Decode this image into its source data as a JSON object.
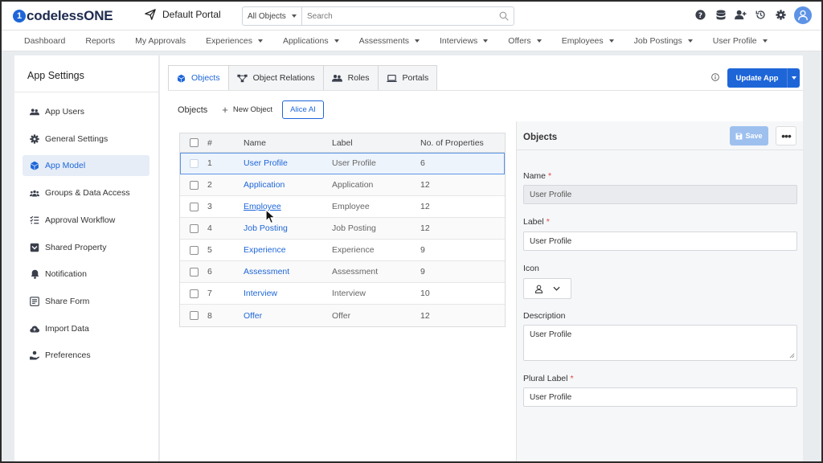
{
  "app": {
    "logo_text": "codelessONE",
    "portal_name": "Default Portal"
  },
  "search": {
    "scope": "All Objects",
    "placeholder": "Search"
  },
  "top_icons": [
    "help-icon",
    "database-icon",
    "user-add-icon",
    "history-icon",
    "settings-icon",
    "avatar-icon"
  ],
  "nav": {
    "items": [
      {
        "label": "Dashboard",
        "dropdown": false
      },
      {
        "label": "Reports",
        "dropdown": false
      },
      {
        "label": "My Approvals",
        "dropdown": false
      },
      {
        "label": "Experiences",
        "dropdown": true
      },
      {
        "label": "Applications",
        "dropdown": true
      },
      {
        "label": "Assessments",
        "dropdown": true
      },
      {
        "label": "Interviews",
        "dropdown": true
      },
      {
        "label": "Offers",
        "dropdown": true
      },
      {
        "label": "Employees",
        "dropdown": true
      },
      {
        "label": "Job Postings",
        "dropdown": true
      },
      {
        "label": "User Profile",
        "dropdown": true
      }
    ]
  },
  "sidebar": {
    "title": "App Settings",
    "items": [
      {
        "label": "App Users",
        "icon": "users-icon"
      },
      {
        "label": "General Settings",
        "icon": "gear-icon"
      },
      {
        "label": "App Model",
        "icon": "cube-icon",
        "active": true
      },
      {
        "label": "Groups & Data Access",
        "icon": "group-icon"
      },
      {
        "label": "Approval Workflow",
        "icon": "checklist-icon"
      },
      {
        "label": "Shared Property",
        "icon": "shared-box-icon"
      },
      {
        "label": "Notification",
        "icon": "bell-icon"
      },
      {
        "label": "Share Form",
        "icon": "form-icon"
      },
      {
        "label": "Import Data",
        "icon": "cloud-upload-icon"
      },
      {
        "label": "Preferences",
        "icon": "hand-icon"
      }
    ]
  },
  "tabs": [
    {
      "label": "Objects",
      "icon": "cube-icon",
      "active": true
    },
    {
      "label": "Object Relations",
      "icon": "relations-icon"
    },
    {
      "label": "Roles",
      "icon": "roles-icon"
    },
    {
      "label": "Portals",
      "icon": "laptop-icon"
    }
  ],
  "toolbar": {
    "update_label": "Update App"
  },
  "objects_bar": {
    "title": "Objects",
    "new_label": "New Object",
    "alice_label": "Alice AI"
  },
  "table": {
    "headers": [
      "#",
      "Name",
      "Label",
      "No. of Properties"
    ],
    "rows": [
      {
        "num": "1",
        "name": "User Profile",
        "label": "User Profile",
        "props": "6",
        "selected": true
      },
      {
        "num": "2",
        "name": "Application",
        "label": "Application",
        "props": "12"
      },
      {
        "num": "3",
        "name": "Employee",
        "label": "Employee",
        "props": "12",
        "hover": true
      },
      {
        "num": "4",
        "name": "Job Posting",
        "label": "Job Posting",
        "props": "12"
      },
      {
        "num": "5",
        "name": "Experience",
        "label": "Experience",
        "props": "9"
      },
      {
        "num": "6",
        "name": "Assessment",
        "label": "Assessment",
        "props": "9"
      },
      {
        "num": "7",
        "name": "Interview",
        "label": "Interview",
        "props": "10"
      },
      {
        "num": "8",
        "name": "Offer",
        "label": "Offer",
        "props": "12"
      }
    ]
  },
  "panel": {
    "title": "Objects",
    "save_label": "Save",
    "name_label": "Name",
    "name_value": "User Profile",
    "label_label": "Label",
    "label_value": "User Profile",
    "icon_label": "Icon",
    "icon_value": "user-icon",
    "description_label": "Description",
    "description_value": "User Profile",
    "plural_label": "Plural Label",
    "plural_value": "User Profile"
  },
  "colors": {
    "accent": "#1e66d8",
    "save_disabled": "#9dc0ef",
    "required": "#e0433d"
  }
}
